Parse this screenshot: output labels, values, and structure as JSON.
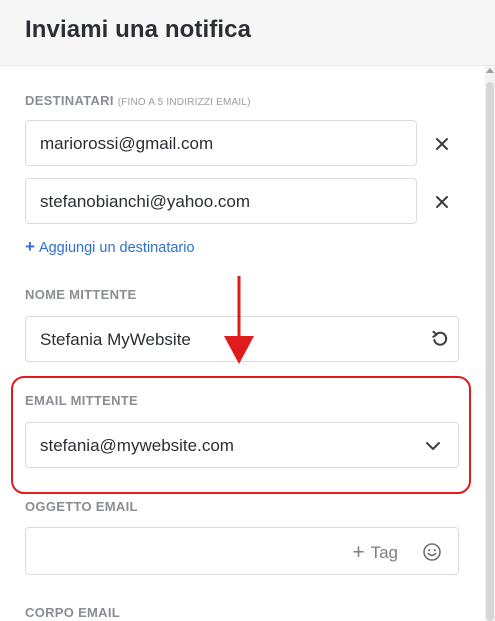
{
  "header": {
    "title": "Inviami una notifica"
  },
  "recipients": {
    "label": "DESTINATARI",
    "hint": "(FINO A 5 INDIRIZZI EMAIL)",
    "items": [
      {
        "value": "mariorossi@gmail.com"
      },
      {
        "value": "stefanobianchi@yahoo.com"
      }
    ],
    "add_label": "Aggiungi un destinatario",
    "remove_glyph": "✕",
    "add_glyph": "+"
  },
  "sender_name": {
    "label": "NOME MITTENTE",
    "value": "Stefania MyWebsite",
    "reset_icon": "undo-icon"
  },
  "sender_email": {
    "label": "EMAIL MITTENTE",
    "value": "stefania@mywebsite.com",
    "dropdown_icon": "chevron-down-icon"
  },
  "subject": {
    "label": "OGGETTO EMAIL",
    "value": "",
    "tag_label": "Tag",
    "tag_glyph": "+",
    "emoji_icon": "smiley-icon"
  },
  "body": {
    "label": "CORPO EMAIL"
  },
  "annotation": {
    "color": "#e01b1b"
  },
  "colors": {
    "link": "#2f6fd6",
    "label": "#8a8d92",
    "text": "#2b2f33",
    "border": "#d9dbde"
  }
}
